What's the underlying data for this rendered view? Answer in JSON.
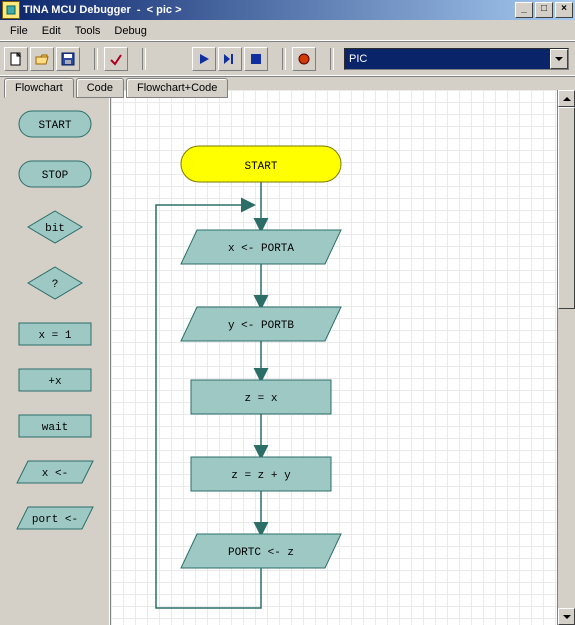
{
  "window": {
    "title": "TINA MCU Debugger  -  < pic >"
  },
  "menu": {
    "file": "File",
    "edit": "Edit",
    "tools": "Tools",
    "debug": "Debug"
  },
  "toolbar": {
    "target_combo": "PIC"
  },
  "tabs": {
    "flowchart": "Flowchart",
    "code": "Code",
    "flowchart_code": "Flowchart+Code"
  },
  "palette": {
    "start": "START",
    "stop": "STOP",
    "bit": "bit",
    "decision": "?",
    "assign": "x = 1",
    "inc": "+x",
    "wait": "wait",
    "io_in": "x <-",
    "io_out": "port <-"
  },
  "flow": {
    "n1": "START",
    "n2": "x <- PORTA",
    "n3": "y <- PORTB",
    "n4": "z = x",
    "n5": "z = z + y",
    "n6": "PORTC <- z"
  },
  "colors": {
    "node_fill": "#9ec8c4",
    "node_stroke": "#2b6e68",
    "start_fill": "#ffff00",
    "start_stroke": "#7a7a00",
    "arrow": "#2b6e68"
  }
}
